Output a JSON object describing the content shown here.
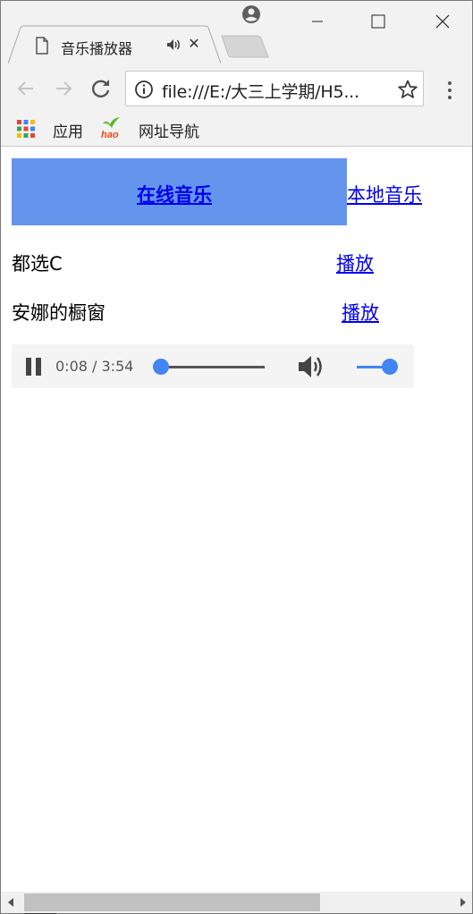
{
  "browser": {
    "tab_title": "音乐播放器",
    "url": "file:///E:/大三上学期/H5...",
    "bookmarks": [
      {
        "label": "应用",
        "icon": "apps-grid-icon"
      },
      {
        "label": "网址导航",
        "icon": "hao-logo-icon"
      }
    ]
  },
  "page": {
    "tabs": {
      "online": "在线音乐",
      "local": "本地音乐"
    },
    "songs": [
      {
        "title": "都选C",
        "play": "播放"
      },
      {
        "title": "安娜的橱窗",
        "play": "播放"
      }
    ],
    "player": {
      "time": "0:08 / 3:54",
      "progress": 0.034,
      "volume": 1.0,
      "accent": "#4285f4"
    }
  },
  "colors": {
    "active_tab_bg": "#6495ed",
    "link": "#0000ee",
    "chrome_bg": "#f2f2f2"
  }
}
